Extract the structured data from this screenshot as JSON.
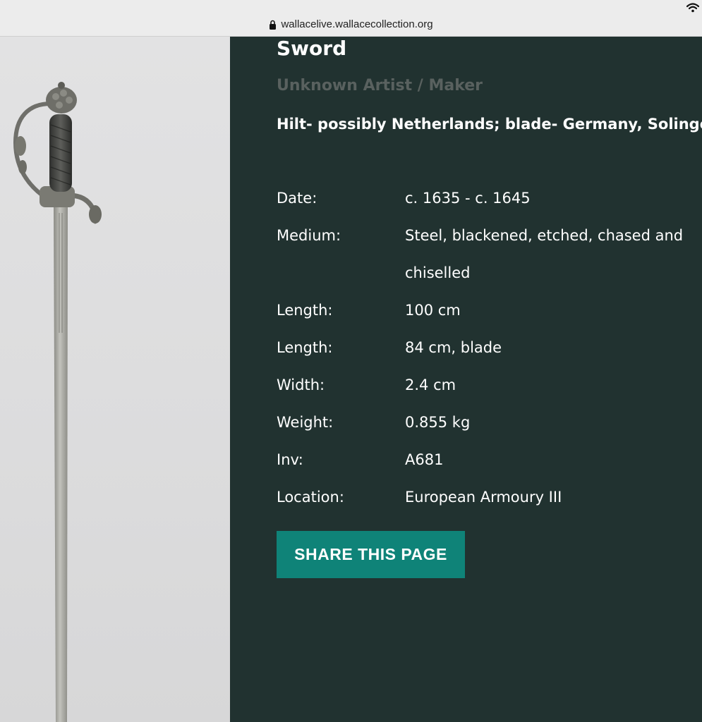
{
  "browser": {
    "url": "wallacelive.wallacecollection.org"
  },
  "object": {
    "title": "Sword",
    "artist": "Unknown Artist / Maker",
    "origin": "Hilt- possibly Netherlands; blade- Germany, Solingen",
    "facts": [
      {
        "label": "Date:",
        "value": "c. 1635 - c. 1645"
      },
      {
        "label": "Medium:",
        "value": "Steel, blackened, etched, chased and chiselled"
      },
      {
        "label": "Length:",
        "value": "100 cm"
      },
      {
        "label": "Length:",
        "value": "84 cm, blade"
      },
      {
        "label": "Width:",
        "value": "2.4 cm"
      },
      {
        "label": "Weight:",
        "value": "0.855 kg"
      },
      {
        "label": "Inv:",
        "value": "A681"
      },
      {
        "label": "Location:",
        "value": "European Armoury III"
      }
    ]
  },
  "actions": {
    "share_label": "SHARE THIS PAGE"
  },
  "icons": {
    "lock": "lock-icon",
    "wifi": "wifi-icon"
  },
  "colors": {
    "panel_bg": "#213230",
    "accent_button": "#0f8378",
    "artist_text": "#59615f"
  }
}
